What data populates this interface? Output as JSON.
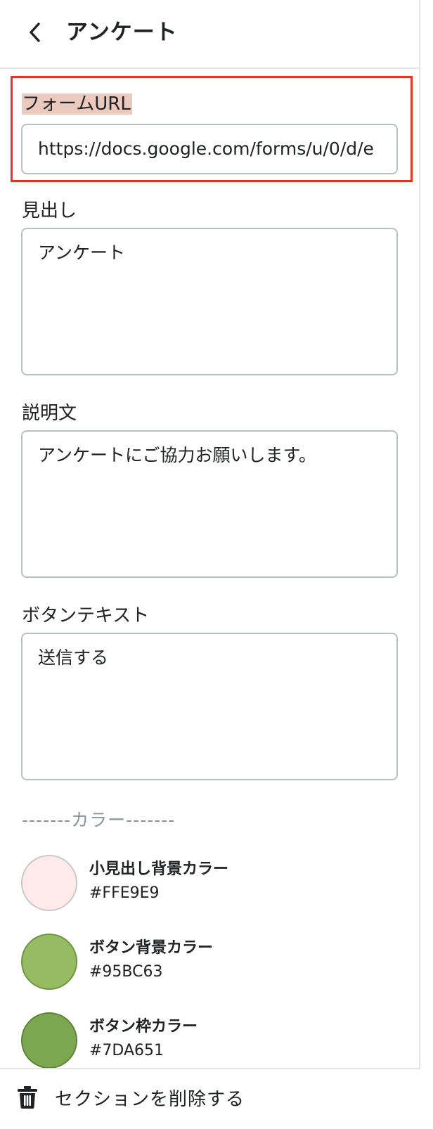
{
  "header": {
    "title": "アンケート",
    "back_icon": "chevron-left-icon"
  },
  "form_url": {
    "label": "フォームURL",
    "value": "https://docs.google.com/forms/u/0/d/e"
  },
  "heading": {
    "label": "見出し",
    "value": "アンケート"
  },
  "description": {
    "label": "説明文",
    "value": "アンケートにご協力お願いします。"
  },
  "button_text": {
    "label": "ボタンテキスト",
    "value": "送信する"
  },
  "colors": {
    "separator": "-------カラー-------",
    "items": [
      {
        "name": "小見出し背景カラー",
        "hex": "#FFE9E9",
        "swatch": "#FFE9E9",
        "border": "#c9c9c9"
      },
      {
        "name": "ボタン背景カラー",
        "hex": "#95BC63",
        "swatch": "#95BC63",
        "border": "#6f9443"
      },
      {
        "name": "ボタン枠カラー",
        "hex": "#7DA651",
        "swatch": "#7DA651",
        "border": "#5e8438"
      }
    ]
  },
  "footer": {
    "delete_label": "セクションを削除する",
    "delete_icon": "trash-icon"
  },
  "accent": {
    "highlight_border": "#e8321e",
    "label_highlight": "#ecc9bf"
  }
}
